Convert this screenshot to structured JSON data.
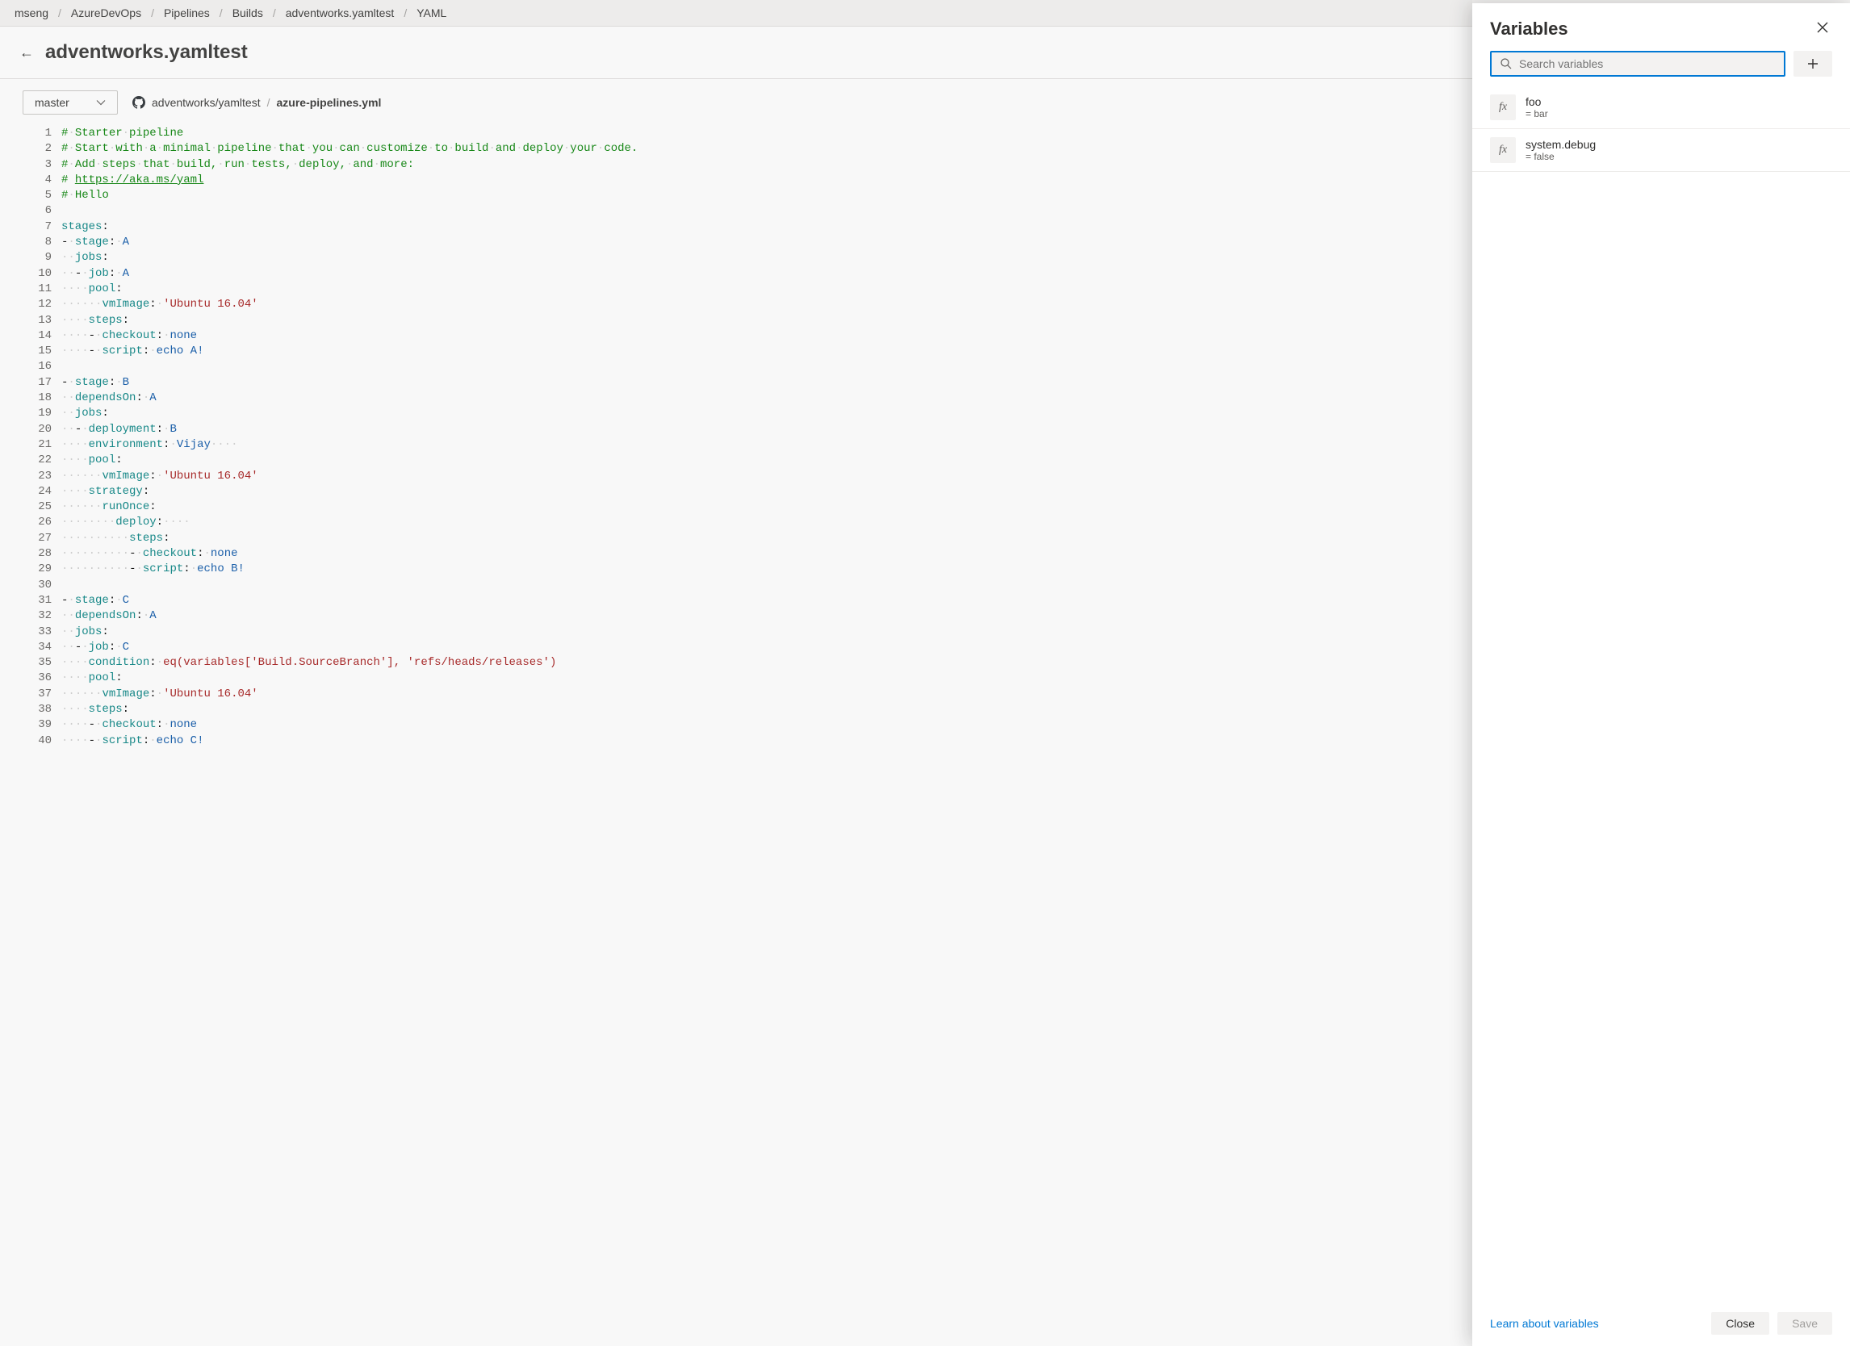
{
  "breadcrumbs": [
    "mseng",
    "AzureDevOps",
    "Pipelines",
    "Builds",
    "adventworks.yamltest",
    "YAML"
  ],
  "page_title": "adventworks.yamltest",
  "branch": "master",
  "repo": {
    "name": "adventworks/yamltest",
    "file": "azure-pipelines.yml"
  },
  "code_lines": [
    {
      "n": 1,
      "t": "comment",
      "text": "# Starter pipeline"
    },
    {
      "n": 2,
      "t": "comment",
      "text": "# Start with a minimal pipeline that you can customize to build and deploy your code."
    },
    {
      "n": 3,
      "t": "comment",
      "text": "# Add steps that build, run tests, deploy, and more:"
    },
    {
      "n": 4,
      "t": "comment-link",
      "prefix": "# ",
      "link": "https://aka.ms/yaml"
    },
    {
      "n": 5,
      "t": "comment",
      "text": "# Hello"
    },
    {
      "n": 6,
      "t": "blank"
    },
    {
      "n": 7,
      "t": "kv",
      "indent": 0,
      "key": "stages",
      "val": ""
    },
    {
      "n": 8,
      "t": "li",
      "indent": 0,
      "key": "stage",
      "val": "A"
    },
    {
      "n": 9,
      "t": "kv",
      "indent": 1,
      "key": "jobs",
      "val": ""
    },
    {
      "n": 10,
      "t": "li",
      "indent": 1,
      "key": "job",
      "val": "A"
    },
    {
      "n": 11,
      "t": "kv",
      "indent": 2,
      "key": "pool",
      "val": ""
    },
    {
      "n": 12,
      "t": "kv",
      "indent": 3,
      "key": "vmImage",
      "val": "'Ubuntu 16.04'",
      "str": true
    },
    {
      "n": 13,
      "t": "kv",
      "indent": 2,
      "key": "steps",
      "val": ""
    },
    {
      "n": 14,
      "t": "li",
      "indent": 2,
      "key": "checkout",
      "val": "none"
    },
    {
      "n": 15,
      "t": "li",
      "indent": 2,
      "key": "script",
      "val": "echo A!"
    },
    {
      "n": 16,
      "t": "blank"
    },
    {
      "n": 17,
      "t": "li",
      "indent": 0,
      "key": "stage",
      "val": "B"
    },
    {
      "n": 18,
      "t": "kv",
      "indent": 1,
      "key": "dependsOn",
      "val": "A"
    },
    {
      "n": 19,
      "t": "kv",
      "indent": 1,
      "key": "jobs",
      "val": ""
    },
    {
      "n": 20,
      "t": "li",
      "indent": 1,
      "key": "deployment",
      "val": "B"
    },
    {
      "n": 21,
      "t": "kv",
      "indent": 2,
      "key": "environment",
      "val": "Vijay",
      "trail": true
    },
    {
      "n": 22,
      "t": "kv",
      "indent": 2,
      "key": "pool",
      "val": ""
    },
    {
      "n": 23,
      "t": "kv",
      "indent": 3,
      "key": "vmImage",
      "val": "'Ubuntu 16.04'",
      "str": true
    },
    {
      "n": 24,
      "t": "kv",
      "indent": 2,
      "key": "strategy",
      "val": ""
    },
    {
      "n": 25,
      "t": "kv",
      "indent": 3,
      "key": "runOnce",
      "val": ""
    },
    {
      "n": 26,
      "t": "kv",
      "indent": 4,
      "key": "deploy",
      "val": "",
      "trail": true
    },
    {
      "n": 27,
      "t": "kv",
      "indent": 5,
      "key": "steps",
      "val": ""
    },
    {
      "n": 28,
      "t": "li",
      "indent": 5,
      "key": "checkout",
      "val": "none"
    },
    {
      "n": 29,
      "t": "li",
      "indent": 5,
      "key": "script",
      "val": "echo B!"
    },
    {
      "n": 30,
      "t": "blank"
    },
    {
      "n": 31,
      "t": "li",
      "indent": 0,
      "key": "stage",
      "val": "C"
    },
    {
      "n": 32,
      "t": "kv",
      "indent": 1,
      "key": "dependsOn",
      "val": "A"
    },
    {
      "n": 33,
      "t": "kv",
      "indent": 1,
      "key": "jobs",
      "val": ""
    },
    {
      "n": 34,
      "t": "li",
      "indent": 1,
      "key": "job",
      "val": "C"
    },
    {
      "n": 35,
      "t": "kv",
      "indent": 2,
      "key": "condition",
      "val": "eq(variables['Build.SourceBranch'], 'refs/heads/releases')",
      "str": true
    },
    {
      "n": 36,
      "t": "kv",
      "indent": 2,
      "key": "pool",
      "val": ""
    },
    {
      "n": 37,
      "t": "kv",
      "indent": 3,
      "key": "vmImage",
      "val": "'Ubuntu 16.04'",
      "str": true
    },
    {
      "n": 38,
      "t": "kv",
      "indent": 2,
      "key": "steps",
      "val": ""
    },
    {
      "n": 39,
      "t": "li",
      "indent": 2,
      "key": "checkout",
      "val": "none"
    },
    {
      "n": 40,
      "t": "li",
      "indent": 2,
      "key": "script",
      "val": "echo C!"
    }
  ],
  "panel": {
    "title": "Variables",
    "search_placeholder": "Search variables",
    "variables": [
      {
        "name": "foo",
        "value": "= bar"
      },
      {
        "name": "system.debug",
        "value": "= false"
      }
    ],
    "learn_link": "Learn about variables",
    "close_btn": "Close",
    "save_btn": "Save"
  }
}
